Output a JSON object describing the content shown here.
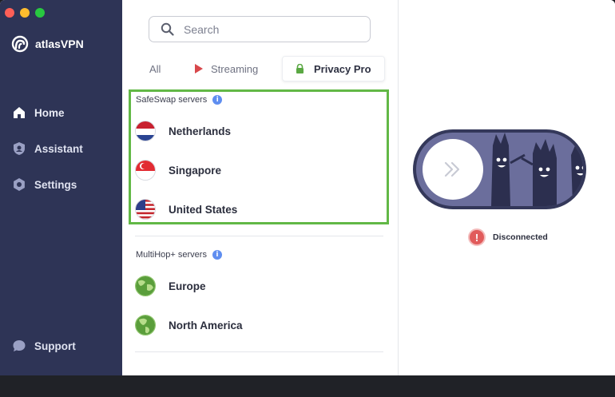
{
  "app": {
    "name": "atlasVPN"
  },
  "sidebar": {
    "items": [
      {
        "label": "Home",
        "icon": "home-icon"
      },
      {
        "label": "Assistant",
        "icon": "assistant-icon"
      },
      {
        "label": "Settings",
        "icon": "gear-icon"
      }
    ],
    "support": {
      "label": "Support",
      "icon": "chat-bubble-icon"
    }
  },
  "search": {
    "placeholder": "Search"
  },
  "tabs": [
    {
      "label": "All"
    },
    {
      "label": "Streaming",
      "icon": "play-icon"
    },
    {
      "label": "Privacy Pro",
      "icon": "lock-icon",
      "active": true
    }
  ],
  "safeswap": {
    "title": "SafeSwap servers",
    "servers": [
      {
        "name": "Netherlands",
        "flag": "netherlands-flag"
      },
      {
        "name": "Singapore",
        "flag": "singapore-flag"
      },
      {
        "name": "United States",
        "flag": "usa-flag"
      }
    ]
  },
  "multihop": {
    "title": "MultiHop+ servers",
    "servers": [
      {
        "name": "Europe",
        "icon": "globe-europe-icon"
      },
      {
        "name": "North America",
        "icon": "globe-americas-icon"
      }
    ]
  },
  "connection": {
    "status": "Disconnected"
  },
  "colors": {
    "sidebar": "#2e3456",
    "accent_green": "#62b846",
    "info_blue": "#5f8ef0",
    "danger": "#e15b5b"
  }
}
